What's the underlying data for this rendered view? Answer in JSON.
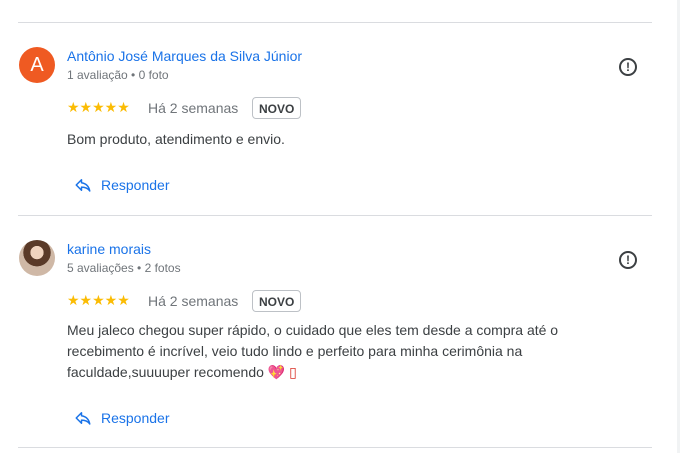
{
  "reviews": [
    {
      "name": "Antônio José Marques da Silva Júnior",
      "meta": "1 avaliação • 0 foto",
      "avatar_letter": "A",
      "stars": "★★★★★",
      "time": "Há 2 semanas",
      "badge": "NOVO",
      "text": "Bom produto, atendimento e envio.",
      "reply": "Responder"
    },
    {
      "name": "karine morais",
      "meta": "5 avaliações • 2 fotos",
      "stars": "★★★★★",
      "time": "Há 2 semanas",
      "badge": "NOVO",
      "text": "Meu jaleco chegou super rápido, o cuidado que eles tem desde a compra até o recebimento é incrível, veio tudo lindo e perfeito para minha cerimônia na faculdade,suuuuper recomendo",
      "emoji": "💖 ▯",
      "reply": "Responder"
    }
  ],
  "colors": {
    "link": "#1a73e8",
    "star": "#fbbc04",
    "avatar_a": "#ef5a22"
  },
  "icons": {
    "report": "report-icon",
    "reply": "reply-arrow-icon"
  }
}
